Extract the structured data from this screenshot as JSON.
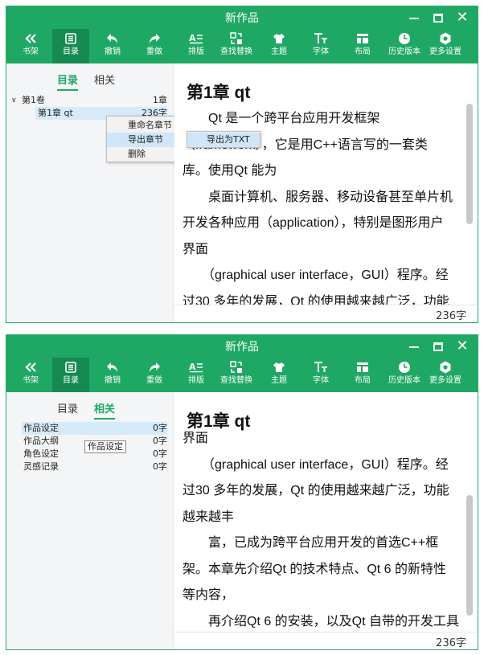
{
  "app": {
    "title": "新作品"
  },
  "toolbar": [
    {
      "id": "bookshelf",
      "label": "书架",
      "icon": "double-chevron-left-icon"
    },
    {
      "id": "toc",
      "label": "目录",
      "icon": "list-icon"
    },
    {
      "id": "undo",
      "label": "撤销",
      "icon": "undo-icon"
    },
    {
      "id": "redo",
      "label": "重做",
      "icon": "redo-icon"
    },
    {
      "id": "typeset",
      "label": "排版",
      "icon": "typeset-icon"
    },
    {
      "id": "find-replace",
      "label": "查找替换",
      "icon": "find-replace-icon"
    },
    {
      "id": "theme",
      "label": "主题",
      "icon": "shirt-icon"
    },
    {
      "id": "font",
      "label": "字体",
      "icon": "font-icon"
    },
    {
      "id": "layout",
      "label": "布局",
      "icon": "layout-icon"
    },
    {
      "id": "history",
      "label": "历史版本",
      "icon": "clock-icon"
    },
    {
      "id": "settings",
      "label": "更多设置",
      "icon": "gear-icon"
    }
  ],
  "sidebar_tabs": {
    "toc": "目录",
    "related": "相关"
  },
  "win1": {
    "active_tool": "toc",
    "active_tab": "toc",
    "tree": [
      {
        "label": "第1卷",
        "count": "1章",
        "level": 0,
        "selected": false
      },
      {
        "label": "第1章 qt",
        "count": "236字",
        "level": 1,
        "selected": true
      }
    ],
    "context_menu": [
      {
        "label": "重命名章节",
        "has_sub": false
      },
      {
        "label": "导出章节",
        "has_sub": true,
        "highlighted": true
      },
      {
        "label": "删除",
        "has_sub": false
      }
    ],
    "submenu": [
      {
        "label": "导出为TXT"
      }
    ],
    "chapter_title": "第1章 qt",
    "lines": [
      "　　Qt 是一个跨平台应用开发框架",
      "（framework），它是用C++语言写的一套类",
      "库。使用Qt 能为",
      "　　桌面计算机、服务器、移动设备甚至单片机",
      "开发各种应用（application），特别是图形用户",
      "界面",
      "　　（graphical user interface，GUI）程序。经",
      "过30 多年的发展，Qt 的使用越来越广泛，功能"
    ],
    "word_count": "236字"
  },
  "win2": {
    "active_tool": "toc",
    "active_tab": "related",
    "related_items": [
      {
        "label": "作品设定",
        "count": "0字",
        "selected": true
      },
      {
        "label": "作品大纲",
        "count": "0字",
        "selected": false
      },
      {
        "label": "角色设定",
        "count": "0字",
        "selected": false
      },
      {
        "label": "灵感记录",
        "count": "0字",
        "selected": false
      }
    ],
    "tooltip": "作品设定",
    "chapter_title": "第1章 qt",
    "lines": [
      "界面",
      "　　（graphical user interface，GUI）程序。经",
      "过30 多年的发展，Qt 的使用越来越广泛，功能",
      "越来越丰",
      "　　富，已成为跨平台应用开发的首选C++框",
      "架。本章先介绍Qt 的技术特点、Qt 6 的新特性",
      "等内容，",
      "　　再介绍Qt 6 的安装，以及Qt 自带的开发工具"
    ],
    "word_count": "236字"
  }
}
